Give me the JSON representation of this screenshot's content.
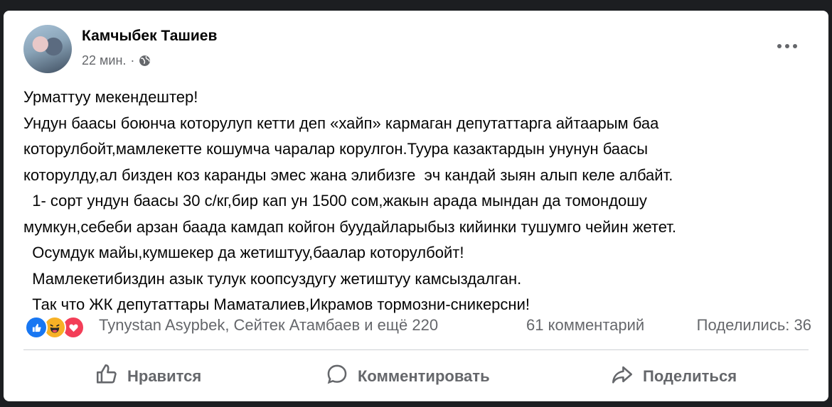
{
  "post": {
    "author": "Камчыбек Ташиев",
    "time": "22 мин.",
    "separator": "·",
    "text_lines": [
      "Урматтуу мекендештер!",
      "Ундун баасы боюнча которулуп кетти деп «хайп» кармаган депутаттарга айтаарым баа",
      "которулбойт,мамлекетте кошумча чаралар корулгон.Туура казактардын унунун баасы",
      "которулду,ал бизден коз каранды эмес жана элибизге  эч кандай зыян алып келе албайт.",
      "  1- сорт ундун баасы 30 с/кг,бир кап ун 1500 сом,жакын арада мындан да томондошу",
      "мумкун,себеби арзан баада камдап койгон буудайларыбыз кийинки тушумго чейин жетет.",
      "  Осумдук майы,кумшекер да жетиштуу,баалар которулбойт!",
      "  Мамлекетибиздин азык тулук коопсуздугу жетиштуу камсыздалган.",
      "  Так что ЖК депутаттары Маматалиев,Икрамов тормозни-сникерсни!"
    ]
  },
  "stats": {
    "reactors": "Tynystan Asypbek, Сейтек Атамбаев и ещё 220",
    "comments": "61 комментарий",
    "shares": "Поделились: 36"
  },
  "actions": {
    "like": "Нравится",
    "comment": "Комментировать",
    "share": "Поделиться"
  },
  "colors": {
    "like_blue": "#1877f2",
    "haha_yellow": "#f7b125",
    "love_red": "#f33e58",
    "secondary_text": "#65676b"
  },
  "icons": [
    "globe-icon",
    "more-icon",
    "like-reaction-icon",
    "haha-reaction-icon",
    "love-reaction-icon",
    "thumbs-up-icon",
    "comment-bubble-icon",
    "share-arrow-icon"
  ]
}
